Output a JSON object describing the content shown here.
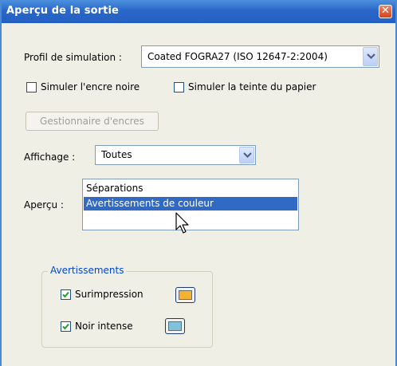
{
  "window": {
    "title": "Aperçu de la sortie",
    "close_glyph": "✕"
  },
  "simulation": {
    "label": "Profil de simulation :",
    "value": "Coated FOGRA27 (ISO 12647-2:2004)"
  },
  "checkboxes": {
    "black_ink": {
      "label": "Simuler l'encre noire",
      "checked": false
    },
    "paper_tint": {
      "label": "Simuler la teinte du papier",
      "checked": false
    }
  },
  "ink_manager_button": {
    "label": "Gestionnaire d'encres",
    "enabled": false
  },
  "display": {
    "label": "Affichage :",
    "value": "Toutes"
  },
  "preview": {
    "label": "Aperçu :",
    "items": [
      "Séparations",
      "Avertissements de couleur"
    ],
    "selected_index": 1
  },
  "warnings": {
    "legend": "Avertissements",
    "overprint": {
      "label": "Surimpression",
      "checked": true,
      "color": "#f5b130"
    },
    "rich_black": {
      "label": "Noir intense",
      "checked": true,
      "color": "#7ec3da"
    }
  },
  "icons": {
    "dropdown": "chevron-down-icon",
    "check": "checkmark-icon",
    "pointer": "cursor-arrow-icon"
  },
  "colors": {
    "titlebar": "#2a67c9",
    "selection": "#316ac5",
    "group_legend": "#0046d5"
  }
}
